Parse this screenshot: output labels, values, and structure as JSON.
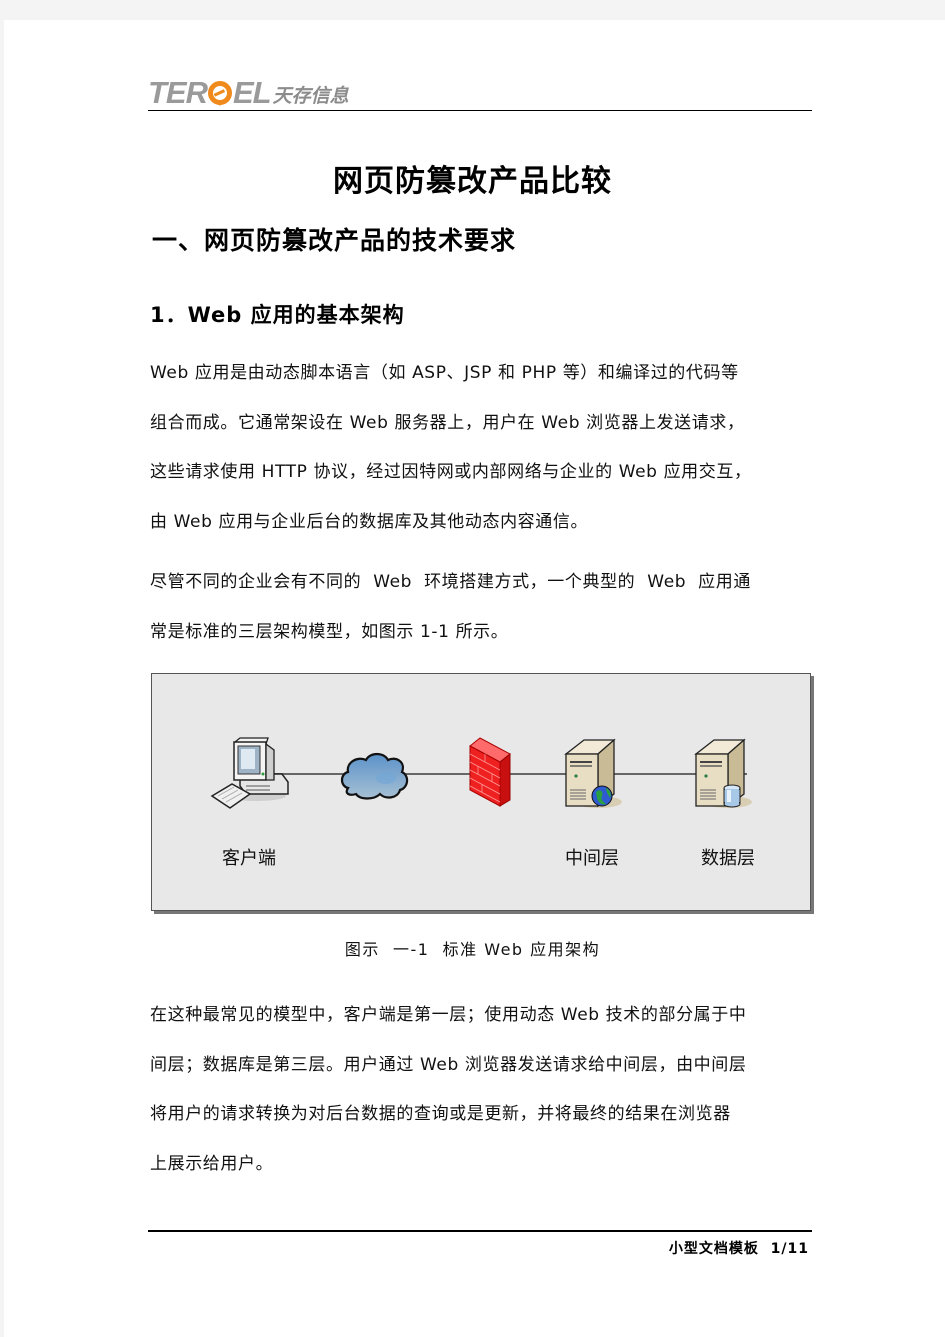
{
  "header": {
    "logo_latin": [
      "TER",
      "EL"
    ],
    "logo_cn": "天存信息",
    "brand_color": "#f08a1c"
  },
  "document": {
    "title": "网页防篡改产品比较",
    "section_heading": "一、网页防篡改产品的技术要求",
    "subsection_heading": "1．Web 应用的基本架构",
    "paragraph1": [
      "Web 应用是由动态脚本语言（如 ASP、JSP 和 PHP 等）和编译过的代码等",
      "组合而成。它通常架设在 Web 服务器上，用户在 Web 浏览器上发送请求，",
      "这些请求使用 HTTP 协议，经过因特网或内部网络与企业的 Web 应用交互，",
      "由 Web 应用与企业后台的数据库及其他动态内容通信。"
    ],
    "paragraph2": [
      "尽管不同的企业会有不同的  Web  环境搭建方式，一个典型的  Web  应用通",
      "常是标准的三层架构模型，如图示 1-1 所示。"
    ],
    "figure": {
      "nodes": [
        {
          "icon": "client-computer-icon",
          "label": "客户端"
        },
        {
          "icon": "internet-cloud-icon",
          "label": ""
        },
        {
          "icon": "firewall-icon",
          "label": ""
        },
        {
          "icon": "web-server-icon",
          "label": "中间层"
        },
        {
          "icon": "database-server-icon",
          "label": "数据层"
        }
      ],
      "caption": "图示  一-1  标准 Web 应用架构"
    },
    "paragraph3": [
      "在这种最常见的模型中，客户端是第一层；使用动态 Web 技术的部分属于中",
      "间层；数据库是第三层。用户通过 Web 浏览器发送请求给中间层，由中间层",
      "将用户的请求转换为对后台数据的查询或是更新，并将最终的结果在浏览器",
      "上展示给用户。"
    ]
  },
  "footer": {
    "template_name": "小型文档模板",
    "page_indicator": "1/11"
  }
}
